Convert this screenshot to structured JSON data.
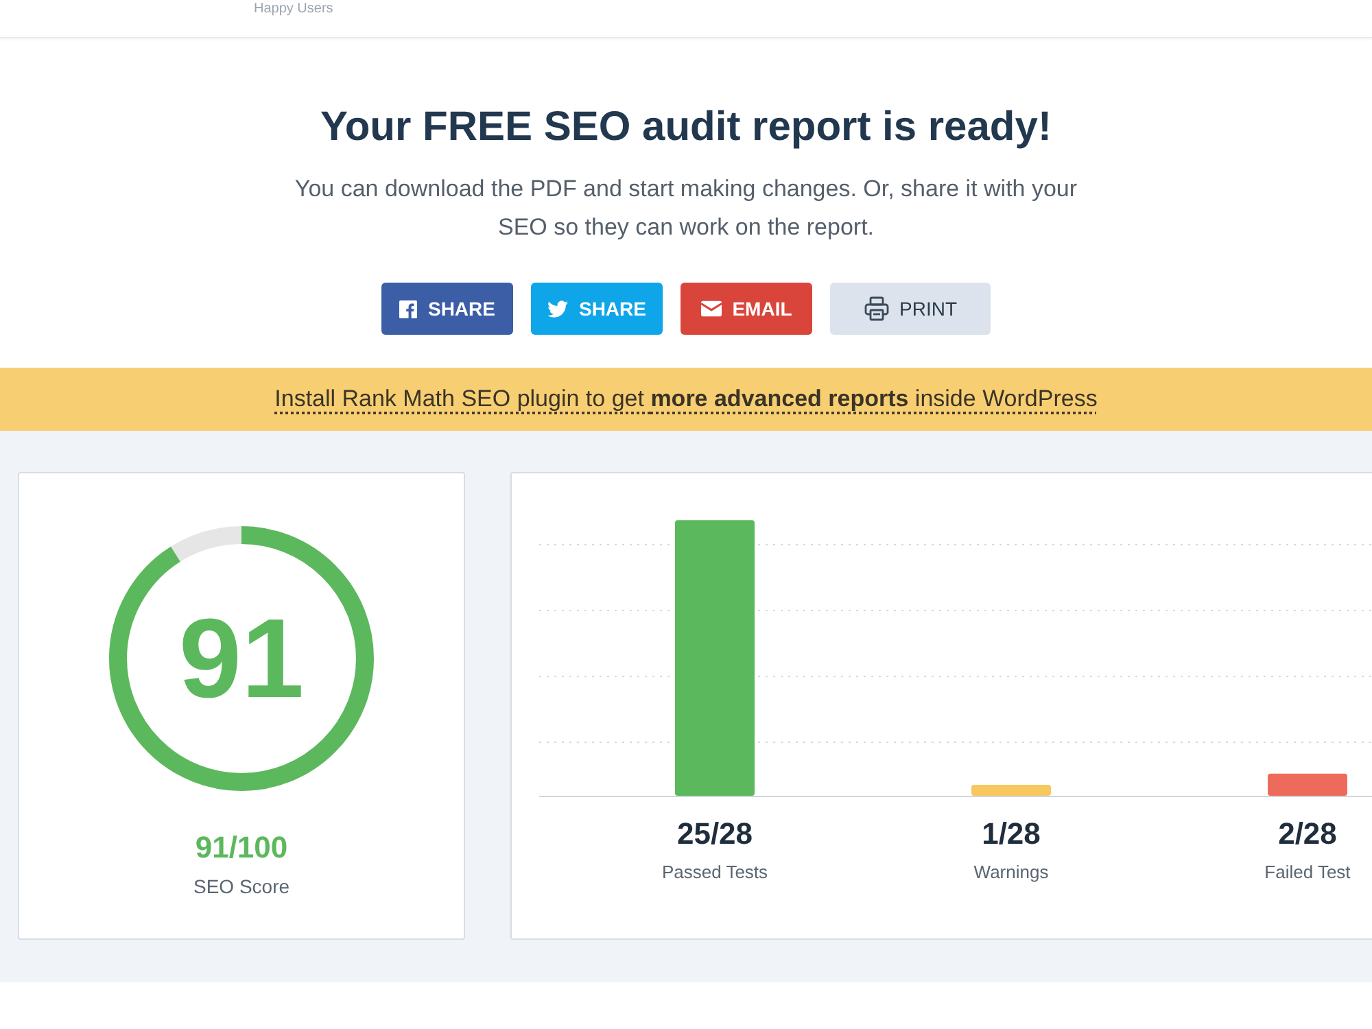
{
  "header": {
    "tagline": "Happy Users"
  },
  "title": "Your FREE SEO audit report is ready!",
  "subtitle": "You can download the PDF and start making changes. Or, share it with your SEO so they can work on the report.",
  "buttons": [
    {
      "kind": "facebook",
      "label": "SHARE"
    },
    {
      "kind": "twitter",
      "label": "SHARE"
    },
    {
      "kind": "email",
      "label": "EMAIL"
    },
    {
      "kind": "print",
      "label": "PRINT"
    }
  ],
  "banner": "Install Rank Math SEO plugin to get **more advanced reports** inside WordPress",
  "score": {
    "number": "91",
    "level": 0.91,
    "value": "91/100",
    "label": "SEO Score"
  },
  "results": {
    "chart_data": {
      "type": "bar",
      "categories": [
        "Passed Tests",
        "Warnings",
        "Failed Test"
      ],
      "values": [
        25,
        1,
        2
      ],
      "value_labels": [
        "25/28",
        "1/28",
        "2/28"
      ],
      "colors": [
        "#5cb85c",
        "#f6c85f",
        "#ee6b5c"
      ]
    }
  }
}
